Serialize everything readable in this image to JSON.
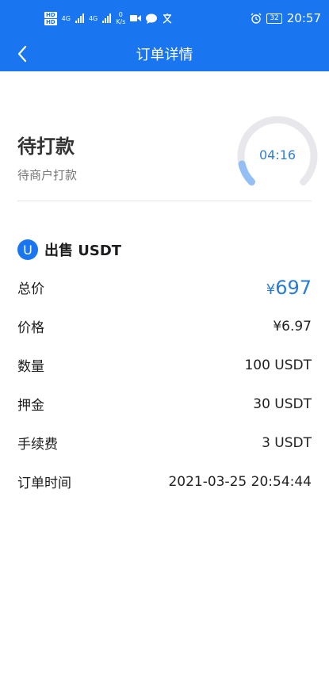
{
  "status_bar": {
    "hd1": "HD",
    "hd2": "HD",
    "net1": "4G",
    "net2": "4G",
    "speed_value": "0",
    "speed_unit": "K/s",
    "battery": "32",
    "time": "20:57"
  },
  "nav": {
    "title": "订单详情"
  },
  "order_status": {
    "title": "待打款",
    "subtitle": "待商户打款",
    "countdown": "04:16",
    "countdown_progress": 0.12,
    "ring_color": "#e8e8ec",
    "progress_color": "#93bff5"
  },
  "order": {
    "badge": "U",
    "type": "出售 USDT",
    "rows": [
      {
        "label": "总价",
        "currency": "¥",
        "value": "697"
      },
      {
        "label": "价格",
        "value": "¥6.97"
      },
      {
        "label": "数量",
        "value": "100 USDT"
      },
      {
        "label": "押金",
        "value": "30 USDT"
      },
      {
        "label": "手续费",
        "value": "3 USDT"
      },
      {
        "label": "订单时间",
        "value": "2021-03-25 20:54:44"
      }
    ]
  },
  "colors": {
    "primary": "#1976f0",
    "total_price": "#2a7bd6"
  }
}
